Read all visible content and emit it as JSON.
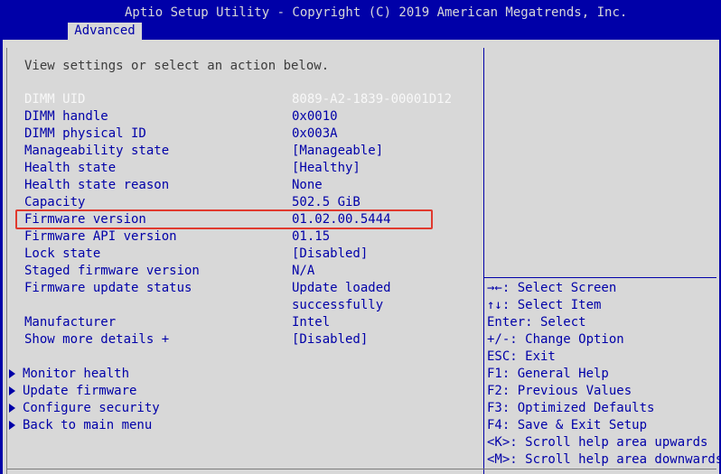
{
  "app": {
    "title": "Aptio Setup Utility - Copyright (C) 2019 American Megatrends, Inc.",
    "active_tab": "Advanced"
  },
  "main": {
    "intro": "View settings or select an action below.",
    "fields": [
      {
        "label": "DIMM UID",
        "value": "8089-A2-1839-00001D12"
      },
      {
        "label": "DIMM handle",
        "value": "0x0010"
      },
      {
        "label": "DIMM physical ID",
        "value": "0x003A"
      },
      {
        "label": "Manageability state",
        "value": "[Manageable]"
      },
      {
        "label": "Health state",
        "value": "[Healthy]"
      },
      {
        "label": "Health state reason",
        "value": "None"
      },
      {
        "label": "Capacity",
        "value": "502.5 GiB"
      },
      {
        "label": "Firmware version",
        "value": "01.02.00.5444"
      },
      {
        "label": "Firmware API version",
        "value": "01.15"
      },
      {
        "label": "Lock state",
        "value": "[Disabled]"
      },
      {
        "label": "Staged firmware version",
        "value": "N/A"
      },
      {
        "label": "Firmware update status",
        "value": "Update loaded",
        "value2": "successfully"
      },
      {
        "label": "Manufacturer",
        "value": "Intel"
      },
      {
        "label": "Show more details +",
        "value": "[Disabled]"
      }
    ],
    "menu": [
      "Monitor health",
      "Update firmware",
      "Configure security",
      "Back to main menu"
    ]
  },
  "help": {
    "items": [
      "→←: Select Screen",
      "↑↓: Select Item",
      "Enter: Select",
      "+/-: Change Option",
      "ESC: Exit",
      "F1: General Help",
      "F2: Previous Values",
      "F3: Optimized Defaults",
      "F4: Save & Exit Setup",
      "<K>: Scroll help area upwards",
      "<M>: Scroll help area downwards"
    ]
  },
  "colors": {
    "background_blue": "#0000a8",
    "panel_gray": "#d8d8d8",
    "highlight_box": "#e0392e"
  }
}
